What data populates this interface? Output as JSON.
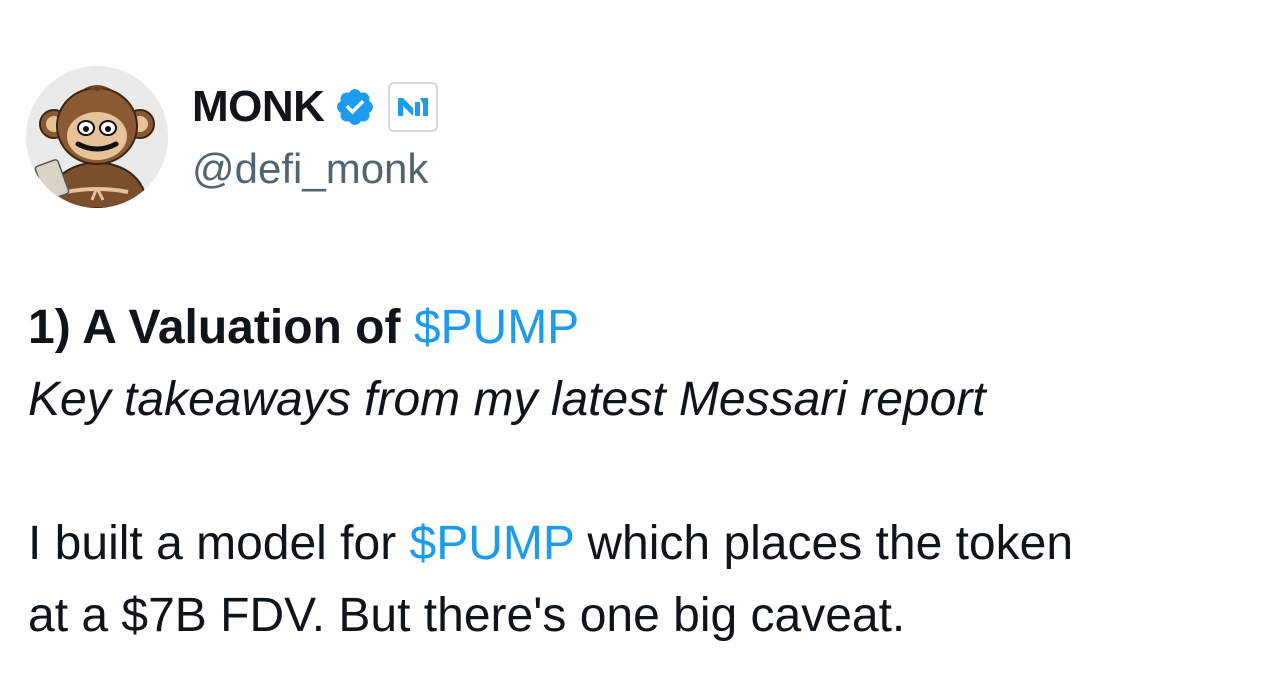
{
  "author": {
    "display_name": "MONK",
    "handle": "@defi_monk",
    "verified_icon": "verified-badge-icon",
    "affiliation_icon": "messari-logo-icon"
  },
  "tweet": {
    "heading_prefix": "1) A Valuation of",
    "heading_cashtag": "$PUMP",
    "subtitle": "Key takeaways from my latest Messari report",
    "body_prefix": "I built a model for",
    "body_cashtag": "$PUMP",
    "body_suffix": "which places the token",
    "body_line2": "at a $7B FDV. But there's one big caveat."
  },
  "colors": {
    "link": "#1d9bf0",
    "text": "#0f1419",
    "secondary": "#536471",
    "verified": "#1d9bf0"
  }
}
